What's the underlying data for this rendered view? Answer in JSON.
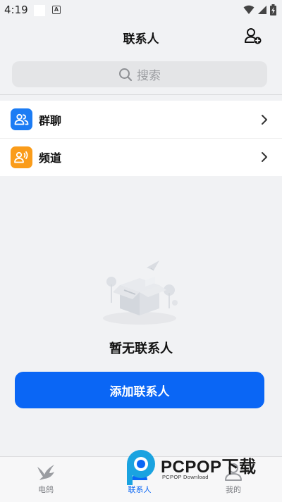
{
  "status_bar": {
    "time": "4:19"
  },
  "header": {
    "title": "联系人"
  },
  "search": {
    "placeholder": "搜索"
  },
  "list": {
    "items": [
      {
        "label": "群聊",
        "icon": "group-icon",
        "color": "#1c7cf4"
      },
      {
        "label": "频道",
        "icon": "channel-icon",
        "color": "#fa9c1a"
      }
    ]
  },
  "empty_state": {
    "text": "暂无联系人"
  },
  "add_button": {
    "label": "添加联系人"
  },
  "tabbar": {
    "tabs": [
      {
        "label": "电鸽",
        "icon": "pigeon-icon",
        "active": false
      },
      {
        "label": "联系人",
        "icon": "contacts-icon",
        "active": true
      },
      {
        "label": "我的",
        "icon": "profile-icon",
        "active": false
      }
    ]
  },
  "watermark": {
    "title": "PCPOP下载",
    "subtitle": "PCPOP Download"
  },
  "colors": {
    "accent": "#0a66f5",
    "group_icon": "#1c7cf4",
    "channel_icon": "#fa9c1a"
  }
}
